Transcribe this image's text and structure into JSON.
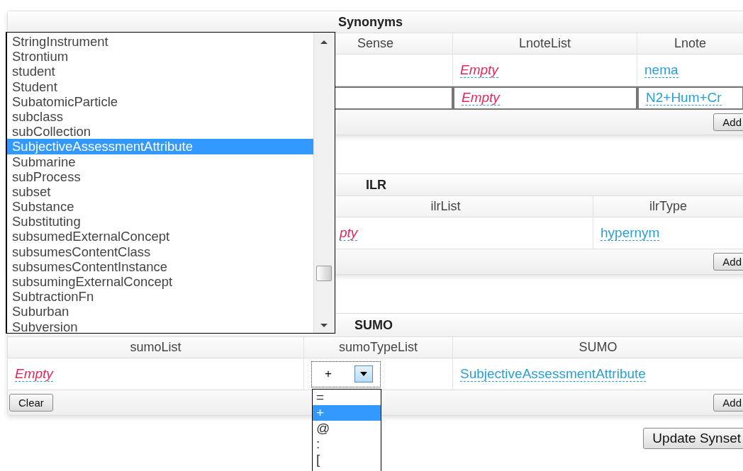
{
  "panels": [
    {
      "kind": "synonyms",
      "title": "Synonyms",
      "columns": [
        "Sense",
        "LnoteList",
        "Lnote"
      ],
      "rows": [
        {
          "selected": false,
          "cells": [
            null,
            {
              "kind": "empty",
              "text": "Empty"
            },
            {
              "kind": "link",
              "text": "nema"
            }
          ]
        },
        {
          "selected": true,
          "cells": [
            null,
            {
              "kind": "empty",
              "text": "Empty"
            },
            {
              "kind": "link",
              "text": "N2+Hum+Cr"
            }
          ]
        }
      ],
      "buttons_right": [
        "Add"
      ]
    },
    {
      "kind": "ilr",
      "title": "ILR",
      "columns": [
        "ilrList",
        "ilrType"
      ],
      "rows": [
        {
          "cells": [
            {
              "kind": "empty",
              "text": "pty"
            },
            {
              "kind": "link",
              "text": "hypernym"
            }
          ]
        }
      ],
      "buttons_right": [
        "Add"
      ]
    },
    {
      "kind": "sumo",
      "title": "SUMO",
      "columns": [
        "sumoList",
        "sumoTypeList",
        "SUMO"
      ],
      "rows": [
        {
          "cells": [
            {
              "kind": "empty",
              "text": "Empty"
            },
            {
              "kind": "select",
              "value": "+",
              "options": [
                {
                  "label": "=",
                  "selected": false
                },
                {
                  "label": "+",
                  "selected": true
                },
                {
                  "label": "@",
                  "selected": false
                },
                {
                  "label": ":",
                  "selected": false
                },
                {
                  "label": "[",
                  "selected": false
                }
              ]
            },
            {
              "kind": "link",
              "text": "SubjectiveAssessmentAttribute"
            }
          ]
        }
      ],
      "buttons_left": [
        "Clear"
      ],
      "buttons_right": [
        "Add"
      ]
    }
  ],
  "update_button": "Update Synset",
  "listbox": {
    "items": [
      {
        "label": "StringInstrument",
        "selected": false
      },
      {
        "label": "Strontium",
        "selected": false
      },
      {
        "label": "student",
        "selected": false
      },
      {
        "label": "Student",
        "selected": false
      },
      {
        "label": "SubatomicParticle",
        "selected": false
      },
      {
        "label": "subclass",
        "selected": false
      },
      {
        "label": "subCollection",
        "selected": false
      },
      {
        "label": "SubjectiveAssessmentAttribute",
        "selected": true
      },
      {
        "label": "Submarine",
        "selected": false
      },
      {
        "label": "subProcess",
        "selected": false
      },
      {
        "label": "subset",
        "selected": false
      },
      {
        "label": "Substance",
        "selected": false
      },
      {
        "label": "Substituting",
        "selected": false
      },
      {
        "label": "subsumedExternalConcept",
        "selected": false
      },
      {
        "label": "subsumesContentClass",
        "selected": false
      },
      {
        "label": "subsumesContentInstance",
        "selected": false
      },
      {
        "label": "subsumingExternalConcept",
        "selected": false
      },
      {
        "label": "SubtractionFn",
        "selected": false
      },
      {
        "label": "Suburban",
        "selected": false
      },
      {
        "label": "Subversion",
        "selected": false
      }
    ]
  }
}
